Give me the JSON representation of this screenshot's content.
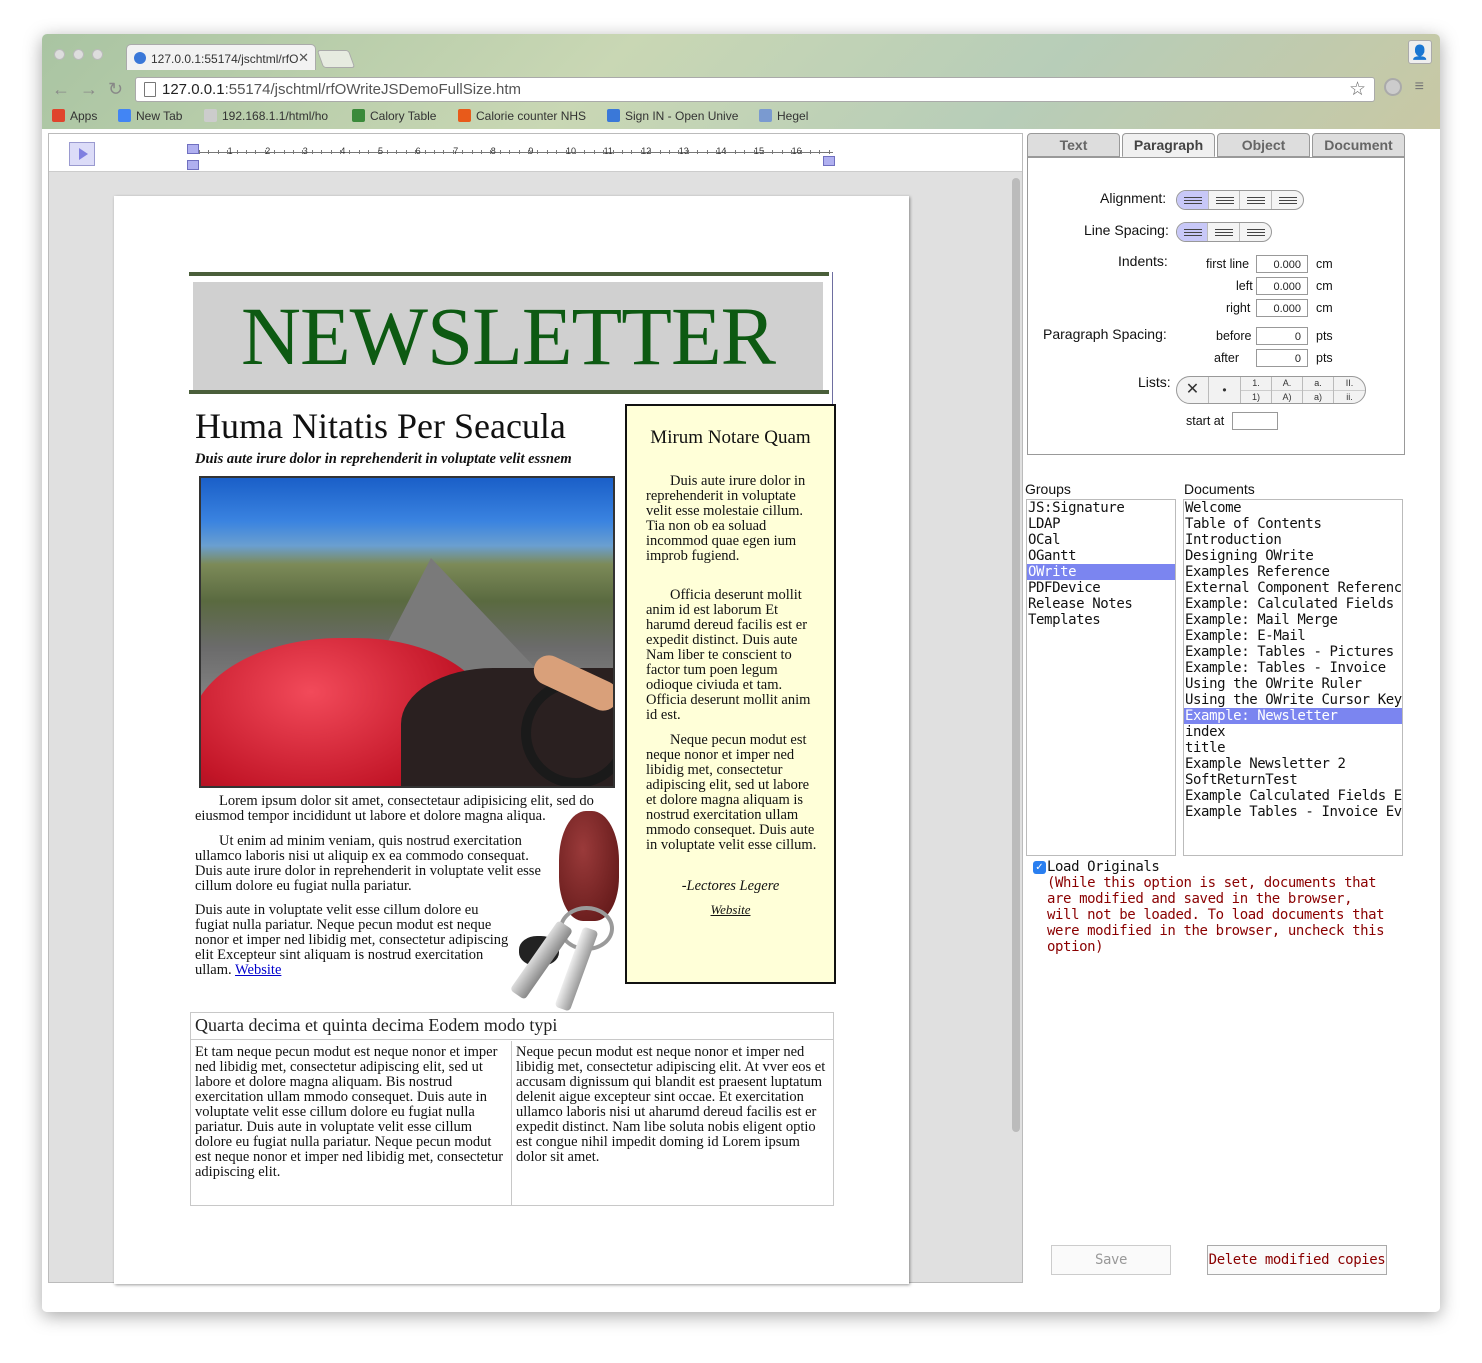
{
  "browser": {
    "tab_title": "127.0.0.1:55174/jschtml/rfO",
    "url_host": "127.0.0.1",
    "url_path": ":55174/jschtml/rfOWriteJSDemoFullSize.htm",
    "bookmarks": [
      {
        "label": "Apps",
        "color": "#e0442d"
      },
      {
        "label": "New Tab",
        "color": "#4285f4"
      },
      {
        "label": "192.168.1.1/html/ho",
        "color": "#cccccc"
      },
      {
        "label": "Calory Table",
        "color": "#3a8a3a"
      },
      {
        "label": "Calorie counter NHS",
        "color": "#e85a1a"
      },
      {
        "label": "Sign IN - Open Unive",
        "color": "#3a78d8"
      },
      {
        "label": "Hegel",
        "color": "#7a9ad0"
      }
    ]
  },
  "ruler": {
    "numbers": [
      "1",
      "2",
      "3",
      "4",
      "5",
      "6",
      "7",
      "8",
      "9",
      "10",
      "11",
      "12",
      "13",
      "14",
      "15",
      "16"
    ]
  },
  "newsletter": {
    "title": "NEWSLETTER",
    "headline": "Huma Nitatis Per Seacula",
    "subhead": "Duis aute irure dolor in reprehenderit in voluptate velit essnem",
    "para1": "Lorem ipsum dolor sit amet, consectetaur adipisicing elit, sed do eiusmod tempor incididunt ut labore et dolore magna aliqua.",
    "para2": "Ut enim ad minim veniam, quis nostrud exercitation ullamco laboris nisi ut aliquip ex ea commodo consequat. Duis aute irure dolor in reprehenderit in voluptate velit esse cillum dolore eu fugiat nulla pariatur.",
    "para3": "Duis aute in voluptate velit esse cillum dolore eu fugiat nulla pariatur. Neque pecun modut est neque nonor et imper ned libidig met, consectetur adipiscing elit Excepteur sint aliquam is nostrud exercitation ullam.",
    "link": "Website",
    "sidebar": {
      "title": "Mirum Notare Quam",
      "p1": "Duis aute irure dolor in reprehenderit in voluptate velit esse molestaie cillum. Tia non ob ea soluad incommod quae egen ium improb fugiend.",
      "p2": "Officia deserunt mollit anim id est laborum Et harumd dereud facilis est er expedit distinct. Duis aute Nam liber te conscient to factor tum poen legum odioque civiuda et tam. Officia deserunt mollit anim id est.",
      "p3": "Neque pecun modut est neque nonor et imper ned libidig met, consectetur adipiscing elit, sed ut labore et dolore magna aliquam is nostrud exercitation ullam mmodo consequet. Duis aute in voluptate velit esse cillum.",
      "signature": "-Lectores Legere",
      "link": "Website"
    },
    "section_title": "Quarta decima et quinta decima Eodem modo typi",
    "col1": "Et tam neque pecun modut est neque nonor et imper ned libidig met, consectetur adipiscing elit, sed ut labore et dolore magna aliquam. Bis nostrud exercitation ullam mmodo consequet. Duis aute in voluptate velit esse cillum dolore eu fugiat nulla pariatur. Duis aute in voluptate velit esse cillum dolore eu fugiat nulla pariatur. Neque pecun modut est neque nonor et imper ned libidig met, consectetur adipiscing elit.",
    "col2": "Neque pecun modut est neque nonor et imper ned libidig met, consectetur adipiscing elit. At vver eos et accusam dignissum qui blandit est praesent luptatum delenit aigue excepteur sint occae. Et exercitation ullamco laboris nisi ut aharumd dereud facilis est er expedit distinct. Nam libe soluta nobis eligent optio est congue nihil impedit doming id Lorem ipsum dolor sit amet."
  },
  "panel": {
    "tabs": [
      "Text",
      "Paragraph",
      "Object",
      "Document"
    ],
    "active_tab": "Paragraph",
    "alignment_label": "Alignment:",
    "line_spacing_label": "Line Spacing:",
    "indents_label": "Indents:",
    "first_line_label": "first line",
    "left_label": "left",
    "right_label": "right",
    "first_line_value": "0.000",
    "left_value": "0.000",
    "right_value": "0.000",
    "cm": "cm",
    "para_spacing_label": "Paragraph Spacing:",
    "before_label": "before",
    "after_label": "after",
    "before_value": "0",
    "after_value": "0",
    "pts": "pts",
    "lists_label": "Lists:",
    "list_none": "✕",
    "list_bullet": "•",
    "list_styles": [
      [
        "1.",
        "1)"
      ],
      [
        "A.",
        "A)"
      ],
      [
        "a.",
        "a)"
      ],
      [
        "II.",
        "ii."
      ]
    ],
    "start_at_label": "start at"
  },
  "groups": {
    "label": "Groups",
    "items": [
      "JS:Signature",
      "LDAP",
      "OCal",
      "OGantt",
      "OWrite",
      "PDFDevice",
      "Release Notes",
      "Templates"
    ],
    "selected": "OWrite"
  },
  "documents": {
    "label": "Documents",
    "items": [
      "Welcome",
      "Table of Contents",
      "Introduction",
      "Designing OWrite",
      "Examples Reference",
      "External Component Reference",
      "Example: Calculated Fields",
      "Example: Mail Merge",
      "Example: E-Mail",
      "Example: Tables - Pictures",
      "Example: Tables - Invoice",
      "Using the OWrite Ruler",
      "Using the OWrite Cursor Keys",
      "Example: Newsletter",
      "index",
      "title",
      "Example Newsletter 2",
      "SoftReturnTest",
      "Example Calculated Fields Eval",
      "Example Tables - Invoice Eval"
    ],
    "selected": "Example: Newsletter"
  },
  "options": {
    "load_originals_label": "Load Originals",
    "load_originals_checked": true,
    "note": "(While this option is set, documents that are modified and saved in the browser, will not be loaded. To load documents that were modified in the browser, uncheck this option)",
    "note_color": "#8a0000"
  },
  "buttons": {
    "save": "Save",
    "delete": "Delete modified copies"
  }
}
